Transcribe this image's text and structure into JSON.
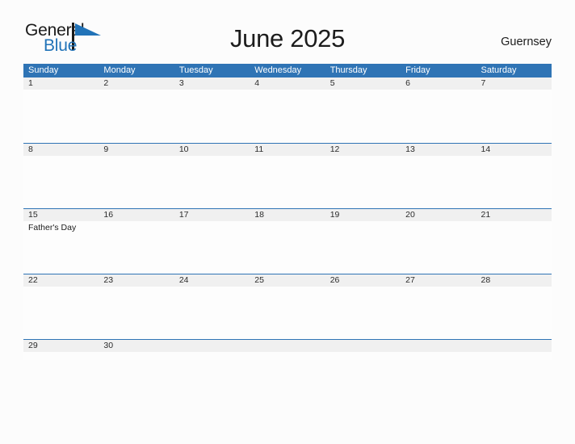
{
  "brand": {
    "name_top": "General",
    "name_bottom": "Blue",
    "flag_icon": "flag-triangle-icon",
    "top_color": "#1a1a1a",
    "bottom_color": "#2173b8",
    "flag_color": "#2173b8"
  },
  "header": {
    "title": "June 2025",
    "locale": "Guernsey"
  },
  "colors": {
    "header_blue": "#2f74b5",
    "date_band_gray": "#f0f0f0",
    "page_background": "#fcfcfc",
    "text": "#1c1c1c"
  },
  "calendar": {
    "weekdays": [
      "Sunday",
      "Monday",
      "Tuesday",
      "Wednesday",
      "Thursday",
      "Friday",
      "Saturday"
    ],
    "weeks": [
      {
        "days": [
          {
            "num": "1",
            "events": []
          },
          {
            "num": "2",
            "events": []
          },
          {
            "num": "3",
            "events": []
          },
          {
            "num": "4",
            "events": []
          },
          {
            "num": "5",
            "events": []
          },
          {
            "num": "6",
            "events": []
          },
          {
            "num": "7",
            "events": []
          }
        ]
      },
      {
        "days": [
          {
            "num": "8",
            "events": []
          },
          {
            "num": "9",
            "events": []
          },
          {
            "num": "10",
            "events": []
          },
          {
            "num": "11",
            "events": []
          },
          {
            "num": "12",
            "events": []
          },
          {
            "num": "13",
            "events": []
          },
          {
            "num": "14",
            "events": []
          }
        ]
      },
      {
        "days": [
          {
            "num": "15",
            "events": [
              "Father's Day"
            ]
          },
          {
            "num": "16",
            "events": []
          },
          {
            "num": "17",
            "events": []
          },
          {
            "num": "18",
            "events": []
          },
          {
            "num": "19",
            "events": []
          },
          {
            "num": "20",
            "events": []
          },
          {
            "num": "21",
            "events": []
          }
        ]
      },
      {
        "days": [
          {
            "num": "22",
            "events": []
          },
          {
            "num": "23",
            "events": []
          },
          {
            "num": "24",
            "events": []
          },
          {
            "num": "25",
            "events": []
          },
          {
            "num": "26",
            "events": []
          },
          {
            "num": "27",
            "events": []
          },
          {
            "num": "28",
            "events": []
          }
        ]
      },
      {
        "days": [
          {
            "num": "29",
            "events": []
          },
          {
            "num": "30",
            "events": []
          },
          {
            "num": "",
            "events": []
          },
          {
            "num": "",
            "events": []
          },
          {
            "num": "",
            "events": []
          },
          {
            "num": "",
            "events": []
          },
          {
            "num": "",
            "events": []
          }
        ]
      }
    ]
  }
}
